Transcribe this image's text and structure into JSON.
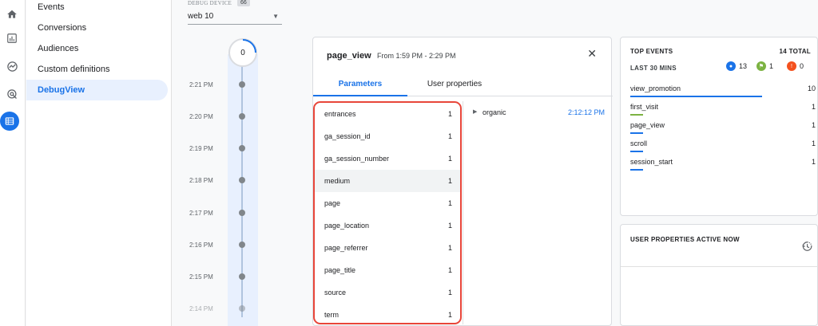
{
  "nav": {
    "items": [
      {
        "label": "Events"
      },
      {
        "label": "Conversions"
      },
      {
        "label": "Audiences"
      },
      {
        "label": "Custom definitions"
      },
      {
        "label": "DebugView"
      }
    ]
  },
  "debug": {
    "label": "DEBUG DEVICE",
    "count": "66",
    "device": "web 10"
  },
  "timeline": {
    "counter": "0",
    "times": [
      "2:21 PM",
      "2:20 PM",
      "2:19 PM",
      "2:18 PM",
      "2:17 PM",
      "2:16 PM",
      "2:15 PM",
      "2:14 PM"
    ]
  },
  "event": {
    "title": "page_view",
    "range": "From 1:59 PM - 2:29 PM",
    "tabs": [
      {
        "label": "Parameters"
      },
      {
        "label": "User properties"
      }
    ],
    "params": [
      {
        "name": "entrances",
        "count": "1"
      },
      {
        "name": "ga_session_id",
        "count": "1"
      },
      {
        "name": "ga_session_number",
        "count": "1"
      },
      {
        "name": "medium",
        "count": "1"
      },
      {
        "name": "page",
        "count": "1"
      },
      {
        "name": "page_location",
        "count": "1"
      },
      {
        "name": "page_referrer",
        "count": "1"
      },
      {
        "name": "page_title",
        "count": "1"
      },
      {
        "name": "source",
        "count": "1"
      },
      {
        "name": "term",
        "count": "1"
      }
    ],
    "selected_value": "organic",
    "selected_time": "2:12:12 PM"
  },
  "top_events": {
    "title": "TOP EVENTS",
    "total": "14 TOTAL",
    "subtitle": "LAST 30 MINS",
    "badges": [
      {
        "value": "13",
        "color": "#1a73e8"
      },
      {
        "value": "1",
        "color": "#7cb342"
      },
      {
        "value": "0",
        "color": "#f4511e"
      }
    ],
    "rows": [
      {
        "name": "view_promotion",
        "count": "10",
        "share": 0.71,
        "color": "#1a73e8"
      },
      {
        "name": "first_visit",
        "count": "1",
        "share": 0.07,
        "color": "#7cb342"
      },
      {
        "name": "page_view",
        "count": "1",
        "share": 0.07,
        "color": "#1a73e8"
      },
      {
        "name": "scroll",
        "count": "1",
        "share": 0.07,
        "color": "#1a73e8"
      },
      {
        "name": "session_start",
        "count": "1",
        "share": 0.07,
        "color": "#1a73e8"
      }
    ]
  },
  "user_props": {
    "title": "USER PROPERTIES ACTIVE NOW"
  }
}
